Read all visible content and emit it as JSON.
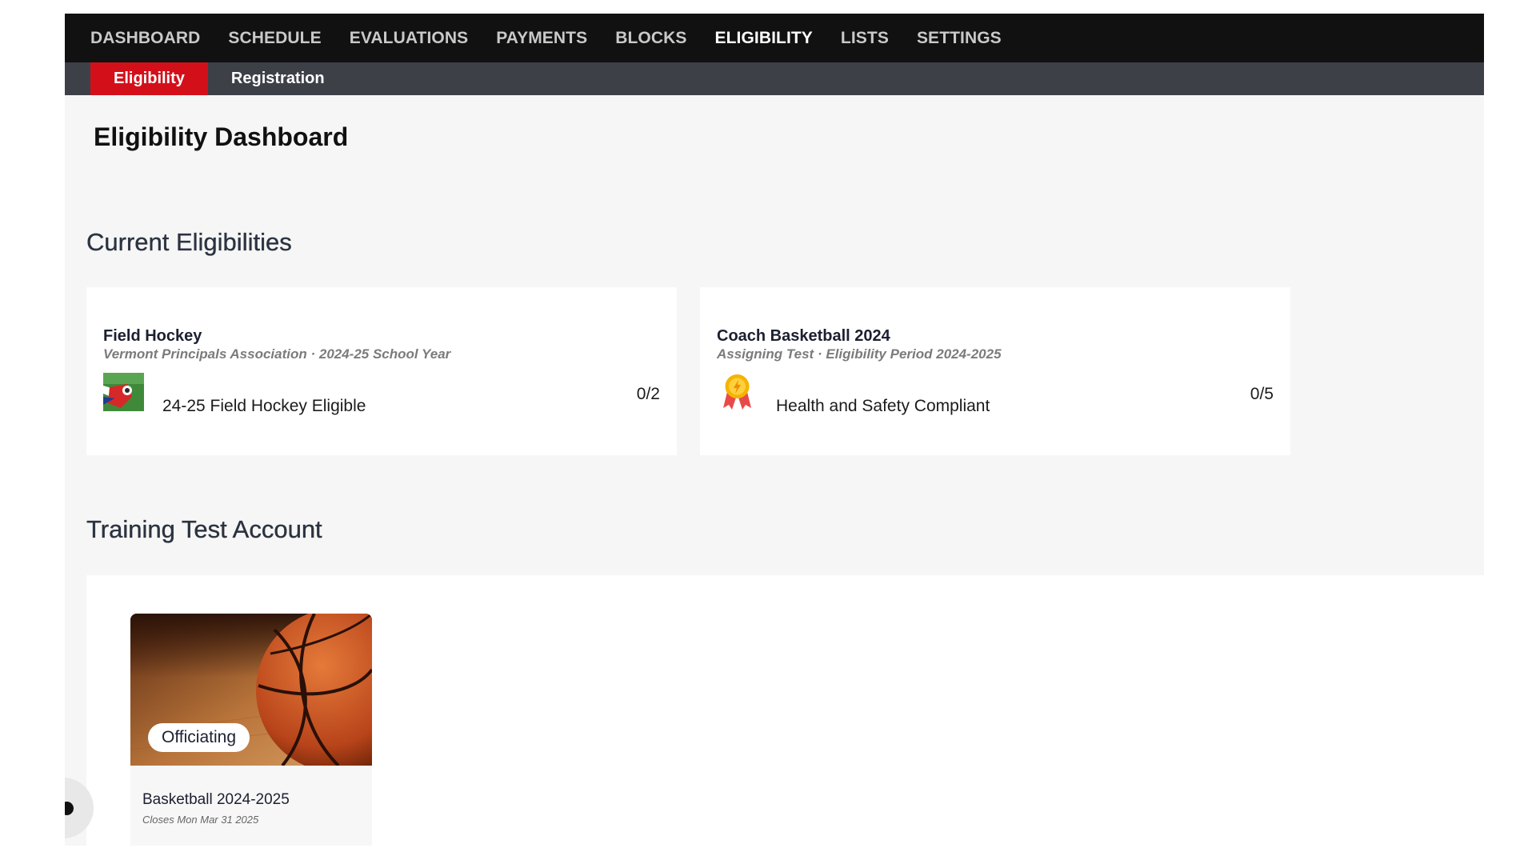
{
  "top_nav": {
    "items": [
      {
        "label": "DASHBOARD",
        "active": false
      },
      {
        "label": "SCHEDULE",
        "active": false
      },
      {
        "label": "EVALUATIONS",
        "active": false
      },
      {
        "label": "PAYMENTS",
        "active": false
      },
      {
        "label": "BLOCKS",
        "active": false
      },
      {
        "label": "ELIGIBILITY",
        "active": true
      },
      {
        "label": "LISTS",
        "active": false
      },
      {
        "label": "SETTINGS",
        "active": false
      }
    ]
  },
  "sub_nav": {
    "items": [
      {
        "label": "Eligibility",
        "active": true
      },
      {
        "label": "Registration",
        "active": false
      }
    ]
  },
  "page": {
    "title": "Eligibility Dashboard"
  },
  "current_eligibilities": {
    "heading": "Current Eligibilities",
    "cards": [
      {
        "title": "Field Hockey",
        "subtitle": "Vermont Principals Association · 2024-25 School Year",
        "item_label": "24-25 Field Hockey Eligible",
        "count": "0/2",
        "icon": "field-hockey-logo-icon"
      },
      {
        "title": "Coach Basketball 2024",
        "subtitle": "Assigning Test · Eligibility Period 2024-2025",
        "item_label": "Health and Safety Compliant",
        "count": "0/5",
        "icon": "award-medal-icon"
      }
    ]
  },
  "training": {
    "heading": "Training Test Account",
    "tiles": [
      {
        "badge": "Officiating",
        "title": "Basketball 2024-2025",
        "subtitle": "Closes Mon Mar 31 2025",
        "image": "basketball-court-image"
      }
    ]
  },
  "colors": {
    "accent_red": "#d3101a",
    "top_nav_bg": "#111111",
    "sub_nav_bg": "#3e4048",
    "page_bg": "#f6f6f6"
  }
}
